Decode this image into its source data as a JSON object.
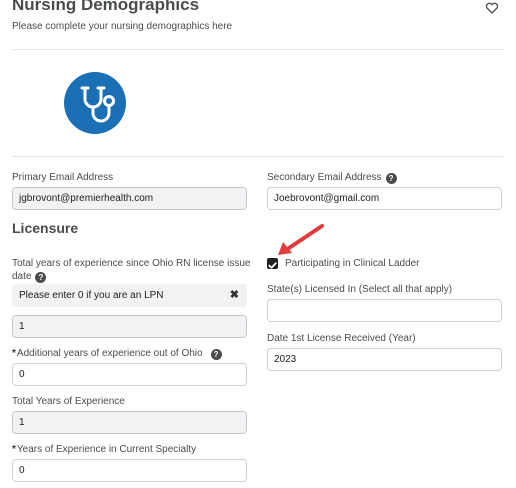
{
  "header": {
    "title": "Nursing Demographics",
    "subtitle": "Please complete your nursing demographics here"
  },
  "icons": {
    "favorite": "heart-outline-icon",
    "avatar": "stethoscope-icon",
    "help": "question-circle-icon",
    "clear": "close-icon",
    "annotation": "red-arrow"
  },
  "colors": {
    "avatar_bg": "#1a6fb5",
    "arrow": "#e23b3b",
    "checkbox": "#202122"
  },
  "fields": {
    "primary_email": {
      "label": "Primary Email Address",
      "value": "jgbrovont@premierhealth.com"
    },
    "secondary_email": {
      "label": "Secondary Email Address",
      "value": "Joebrovont@gmail.com"
    },
    "ohio_experience": {
      "label_line1": "Total years of experience since Ohio RN license issue",
      "label_line2": "date",
      "hint": "Please enter 0 if you are an LPN",
      "value": "1"
    },
    "out_of_ohio": {
      "required": "*",
      "label": "Additional years of experience out of Ohio",
      "value": "0"
    },
    "total_experience": {
      "label": "Total Years of Experience",
      "value": "1"
    },
    "current_specialty": {
      "required": "*",
      "label": "Years of Experience in Current Specialty",
      "value": "0"
    },
    "clinical_ladder": {
      "label": "Participating in Clinical Ladder",
      "checked": true
    },
    "states_licensed": {
      "label": "State(s) Licensed In (Select all that apply)",
      "value": ""
    },
    "first_license_year": {
      "label": "Date 1st License Received (Year)",
      "value": "2023"
    }
  },
  "sections": {
    "licensure": "Licensure"
  }
}
